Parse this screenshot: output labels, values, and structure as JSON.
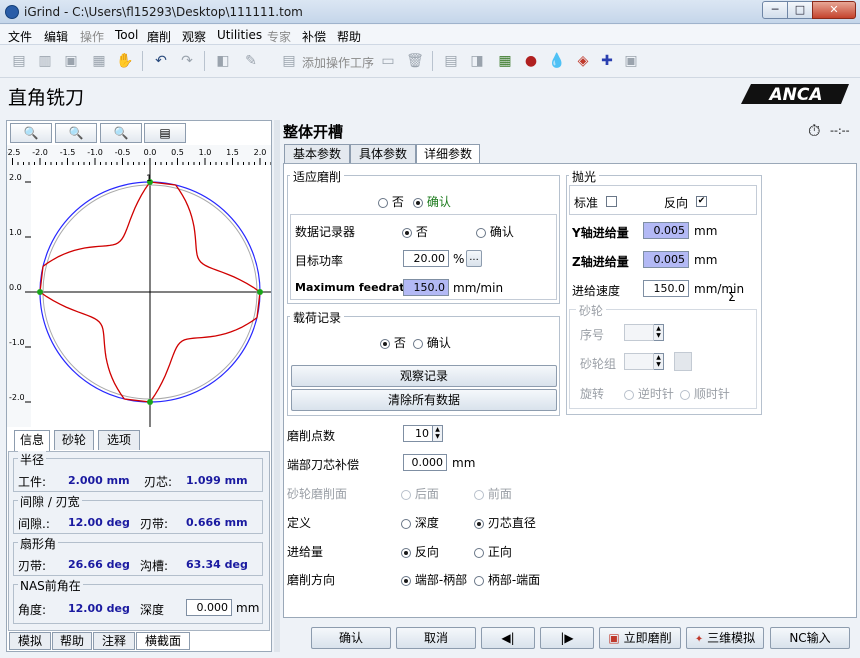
{
  "window": {
    "title": "iGrind  -  C:\\Users\\fl15293\\Desktop\\111111.tom",
    "min": "─",
    "max": "□",
    "close": "✕"
  },
  "menu": [
    "文件",
    "编辑",
    "操作",
    "Tool",
    "磨削",
    "观察",
    "Utilities",
    "专家",
    "补偿",
    "帮助"
  ],
  "toolbar": {
    "add_operation_label": "添加操作工序"
  },
  "header": {
    "page_title": "直角铣刀",
    "brand": "ANCA"
  },
  "plot": {
    "x_ticks": [
      "-2.5",
      "-2.0",
      "-1.5",
      "-1.0",
      "-0.5",
      "0.0",
      "0.5",
      "1.0",
      "1.5",
      "2.0"
    ],
    "y_ticks": [
      "2.0",
      "1.0",
      "0.0",
      "-1.0",
      "-2.0"
    ],
    "top_marker": "1"
  },
  "left_tabs": [
    "信息",
    "砂轮",
    "选项"
  ],
  "info": {
    "radius": {
      "title": "半径",
      "work_label": "工件:",
      "work_value": "2.000 mm",
      "core_label": "刃芯:",
      "core_value": "1.099 mm"
    },
    "spacing": {
      "title": "间隙 / 刃宽",
      "gap_label": "间隙.:",
      "gap_value": "12.00 deg",
      "land_label": "刃带:",
      "land_value": "0.666 mm"
    },
    "fan": {
      "title": "扇形角",
      "land_label": "刃带:",
      "land_value": "26.66 deg",
      "flute_label": "沟槽:",
      "flute_value": "63.34 deg"
    },
    "nas": {
      "title": "NAS前角在",
      "angle_label": "角度:",
      "angle_value": "12.00 deg",
      "depth_label": "深度",
      "depth_value": "0.000",
      "depth_unit": "mm"
    }
  },
  "bottom_tabs": [
    "模拟",
    "帮助",
    "注释",
    "横截面"
  ],
  "right": {
    "title": "整体开槽",
    "timer": "--:--",
    "tabs": [
      "基本参数",
      "具体参数",
      "详细参数"
    ],
    "adaptive": {
      "title": "适应磨削",
      "no": "否",
      "yes": "确认",
      "recorder_label": "数据记录器",
      "recorder_no": "否",
      "recorder_yes": "确认",
      "target_power_label": "目标功率",
      "target_power_value": "20.00",
      "target_power_unit": "%",
      "max_feed_label": "Maximum feedrate",
      "max_feed_value": "150.0",
      "max_feed_unit": "mm/min"
    },
    "load_record": {
      "title": "载荷记录",
      "no": "否",
      "yes": "确认",
      "view_button": "观察记录",
      "clear_button": "清除所有数据"
    },
    "polish": {
      "title": "抛光",
      "standard_label": "标准",
      "reverse_label": "反向",
      "y_feed_label": "Y轴进给量",
      "y_feed_value": "0.005",
      "y_feed_unit": "mm",
      "z_feed_label": "Z轴进给量",
      "z_feed_value": "0.005",
      "z_feed_unit": "mm",
      "speed_label": "进给速度",
      "speed_value": "150.0",
      "speed_unit": "mm/min",
      "sigma": "Σ",
      "wheel": {
        "title": "砂轮",
        "seq_label": "序号",
        "group_label": "砂轮组",
        "rotate_label": "旋转",
        "ccw": "逆时针",
        "cw": "顺时针"
      }
    },
    "fields": {
      "points_label": "磨削点数",
      "points_value": "10",
      "end_comp_label": "端部刀芯补偿",
      "end_comp_value": "0.000",
      "end_comp_unit": "mm",
      "wheel_face_label": "砂轮磨削面",
      "wheel_face_back": "后面",
      "wheel_face_front": "前面",
      "define_label": "定义",
      "define_depth": "深度",
      "define_core": "刃芯直径",
      "feed_label": "进给量",
      "feed_reverse": "反向",
      "feed_forward": "正向",
      "dir_label": "磨削方向",
      "dir_end_shank": "端部-柄部",
      "dir_shank_end": "柄部-端面"
    }
  },
  "actions": {
    "ok": "确认",
    "cancel": "取消",
    "prev": "◀|",
    "next": "|▶",
    "grind_now": "立即磨削",
    "sim3d": "三维模拟",
    "nc_input": "NC输入"
  }
}
